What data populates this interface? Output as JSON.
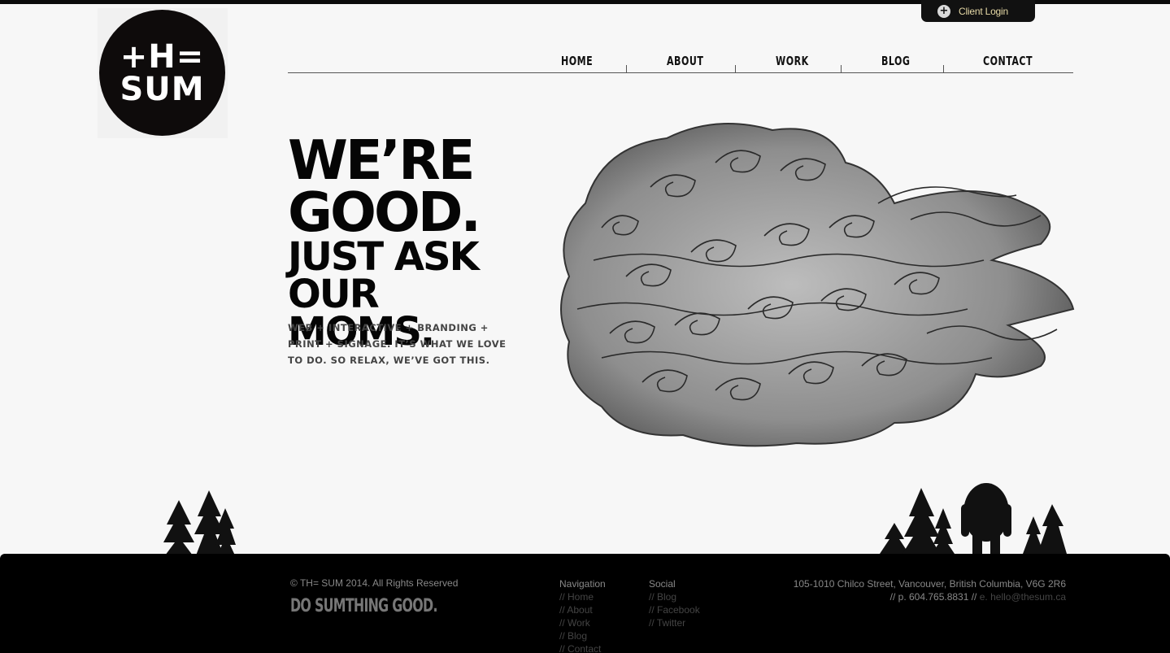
{
  "header": {
    "client_login": "Client Login",
    "logo": {
      "line1": "+H=",
      "line2": "SUM"
    }
  },
  "nav": {
    "items": [
      "HOME",
      "ABOUT",
      "WORK",
      "BLOG",
      "CONTACT"
    ]
  },
  "hero": {
    "line1": "WE’RE",
    "line2": "GOOD.",
    "line3": "JUST ASK",
    "line4": "OUR MOMS.",
    "tagline_1": "WEB + INTERACTIVE + BRANDING +",
    "tagline_2": "PRINT + SIGNAGE. IT’S WHAT WE LOVE",
    "tagline_3": "TO DO. SO RELAX, WE’VE GOT THIS."
  },
  "footer": {
    "copyright": "© TH= SUM 2014. All Rights Reserved",
    "slogan": "DO SUMTHING GOOD.",
    "navigation": {
      "heading": "Navigation",
      "items": [
        "// Home",
        "// About",
        "// Work",
        "// Blog",
        "// Contact"
      ]
    },
    "social": {
      "heading": "Social",
      "items": [
        "// Blog",
        "// Facebook",
        "// Twitter"
      ]
    },
    "address": "105-1010 Chilco Street, Vancouver, British Columbia, V6G 2R6",
    "phone": "// p. 604.765.8831 //",
    "email": "e. hello@thesum.ca"
  },
  "colors": {
    "background": "#f7f7f7",
    "footer": "#000000",
    "client_login_text": "#e6d9a6"
  },
  "icons": {
    "client_login": "plus-circle-icon"
  }
}
